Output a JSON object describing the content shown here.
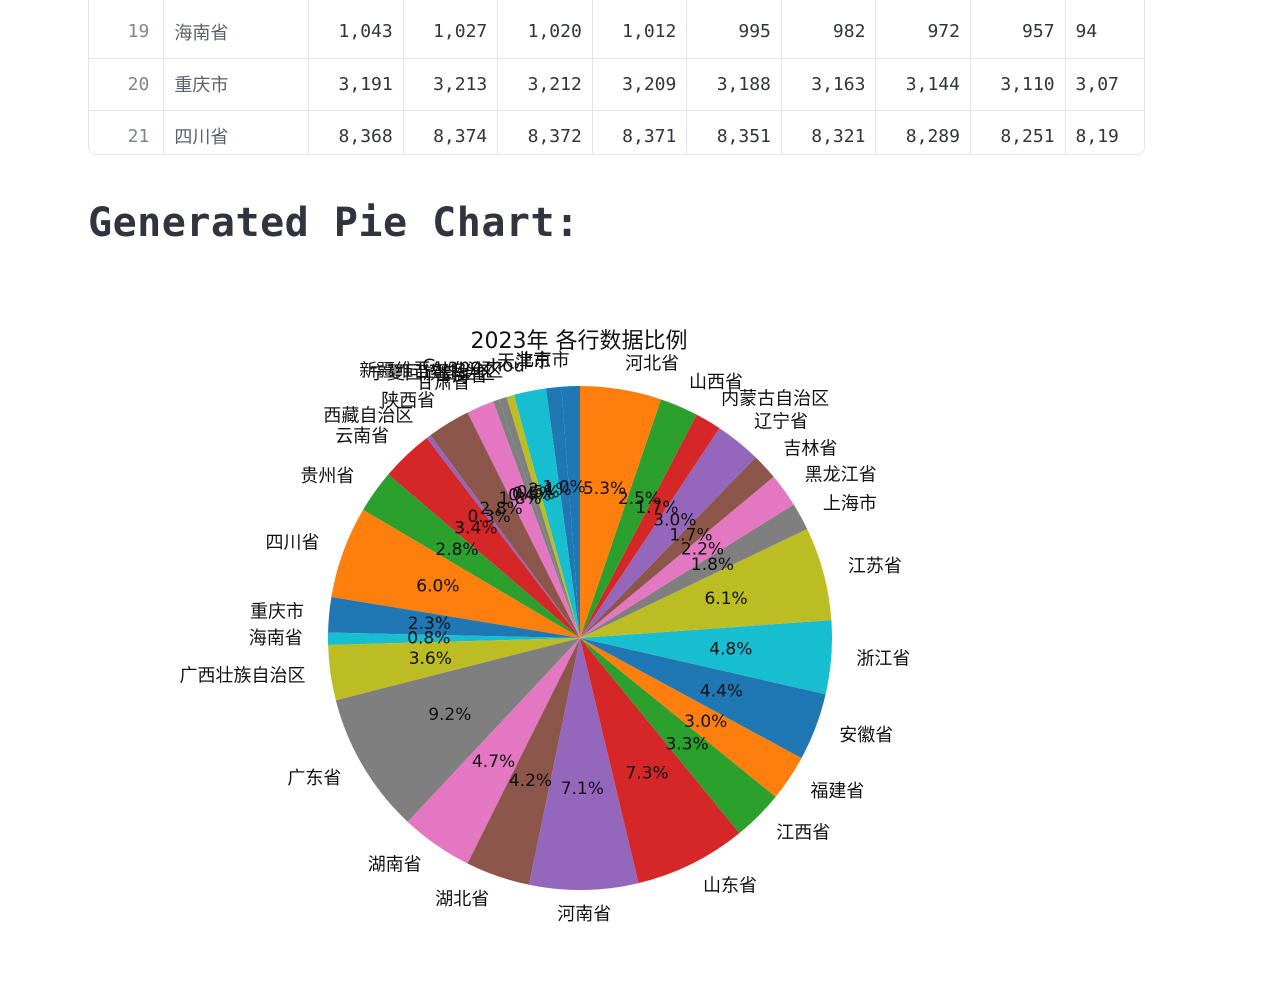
{
  "table": {
    "rows": [
      {
        "index": "19",
        "province": "海南省",
        "values": [
          "1,043",
          "1,027",
          "1,020",
          "1,012",
          "995",
          "982",
          "972",
          "957",
          "94"
        ]
      },
      {
        "index": "20",
        "province": "重庆市",
        "values": [
          "3,191",
          "3,213",
          "3,212",
          "3,209",
          "3,188",
          "3,163",
          "3,144",
          "3,110",
          "3,07"
        ]
      },
      {
        "index": "21",
        "province": "四川省",
        "values": [
          "8,368",
          "8,374",
          "8,372",
          "8,371",
          "8,351",
          "8,321",
          "8,289",
          "8,251",
          "8,19"
        ]
      }
    ]
  },
  "heading": "Generated Pie Chart:",
  "chart_data": {
    "type": "pie",
    "title": "2023年 各行数据比例",
    "start_angle_deg": 90,
    "direction": "counterclockwise",
    "slices": [
      {
        "label": "北京市",
        "pct": 1.2,
        "pct_label": "",
        "color": "#1f77b4"
      },
      {
        "label": "天津市",
        "pct": 1.0,
        "pct_label": "1.0%",
        "color": "#1f77b4"
      },
      {
        "label": "Guangzhou",
        "pct": 2.1,
        "pct_label": "2.1%",
        "color": "#17becf"
      },
      {
        "label": "新疆维吾尔自治区",
        "pct": 0.5,
        "pct_label": "0.5%",
        "color": "#bcbd22"
      },
      {
        "label": "宁夏回族自治区",
        "pct": 0.5,
        "pct_label": "0.5%",
        "color": "#7f7f7f"
      },
      {
        "label": "青海省",
        "pct": 0.4,
        "pct_label": "0.4%",
        "color": "#7f7f7f"
      },
      {
        "label": "甘肃省",
        "pct": 1.8,
        "pct_label": "1.8%",
        "color": "#e377c2"
      },
      {
        "label": "陕西省",
        "pct": 2.8,
        "pct_label": "2.8%",
        "color": "#8c564b"
      },
      {
        "label": "西藏自治区",
        "pct": 0.3,
        "pct_label": "0.3%",
        "color": "#9467bd"
      },
      {
        "label": "云南省",
        "pct": 3.4,
        "pct_label": "3.4%",
        "color": "#d62728"
      },
      {
        "label": "贵州省",
        "pct": 2.8,
        "pct_label": "2.8%",
        "color": "#2ca02c"
      },
      {
        "label": "四川省",
        "pct": 6.0,
        "pct_label": "6.0%",
        "color": "#ff7f0e"
      },
      {
        "label": "重庆市",
        "pct": 2.3,
        "pct_label": "2.3%",
        "color": "#1f77b4"
      },
      {
        "label": "海南省",
        "pct": 0.8,
        "pct_label": "0.8%",
        "color": "#17becf"
      },
      {
        "label": "广西壮族自治区",
        "pct": 3.6,
        "pct_label": "3.6%",
        "color": "#bcbd22"
      },
      {
        "label": "广东省",
        "pct": 9.2,
        "pct_label": "9.2%",
        "color": "#7f7f7f"
      },
      {
        "label": "湖南省",
        "pct": 4.7,
        "pct_label": "4.7%",
        "color": "#e377c2"
      },
      {
        "label": "湖北省",
        "pct": 4.2,
        "pct_label": "4.2%",
        "color": "#8c564b"
      },
      {
        "label": "河南省",
        "pct": 7.1,
        "pct_label": "7.1%",
        "color": "#9467bd"
      },
      {
        "label": "山东省",
        "pct": 7.3,
        "pct_label": "7.3%",
        "color": "#d62728"
      },
      {
        "label": "江西省",
        "pct": 3.3,
        "pct_label": "3.3%",
        "color": "#2ca02c"
      },
      {
        "label": "福建省",
        "pct": 3.0,
        "pct_label": "3.0%",
        "color": "#ff7f0e"
      },
      {
        "label": "安徽省",
        "pct": 4.4,
        "pct_label": "4.4%",
        "color": "#1f77b4"
      },
      {
        "label": "浙江省",
        "pct": 4.8,
        "pct_label": "4.8%",
        "color": "#17becf"
      },
      {
        "label": "江苏省",
        "pct": 6.1,
        "pct_label": "6.1%",
        "color": "#bcbd22"
      },
      {
        "label": "上海市",
        "pct": 1.8,
        "pct_label": "1.8%",
        "color": "#7f7f7f"
      },
      {
        "label": "黑龙江省",
        "pct": 2.2,
        "pct_label": "2.2%",
        "color": "#e377c2"
      },
      {
        "label": "吉林省",
        "pct": 1.7,
        "pct_label": "1.7%",
        "color": "#8c564b"
      },
      {
        "label": "辽宁省",
        "pct": 3.0,
        "pct_label": "3.0%",
        "color": "#9467bd"
      },
      {
        "label": "内蒙古自治区",
        "pct": 1.7,
        "pct_label": "1.7%",
        "color": "#d62728"
      },
      {
        "label": "山西省",
        "pct": 2.5,
        "pct_label": "2.5%",
        "color": "#2ca02c"
      },
      {
        "label": "河北省",
        "pct": 5.3,
        "pct_label": "5.3%",
        "color": "#ff7f0e"
      }
    ]
  }
}
